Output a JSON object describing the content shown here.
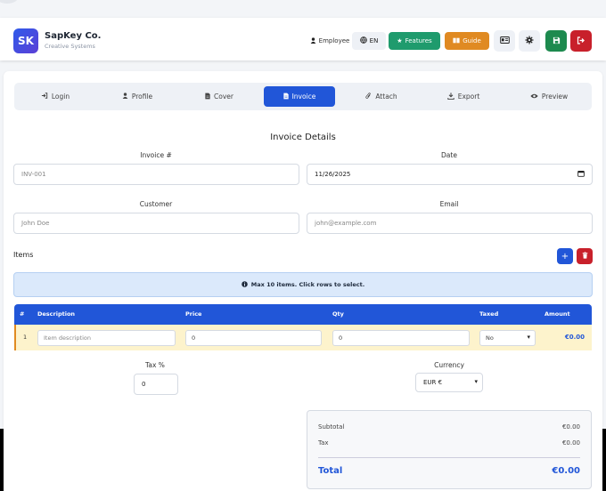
{
  "header": {
    "logo_text": "SK",
    "brand_name": "SapKey Co.",
    "brand_sub": "Creative Systems",
    "role_label": "Employee",
    "lang_label": "EN",
    "features_label": "Features",
    "guide_label": "Guide",
    "colors": {
      "features": "#1f9b6d",
      "guide": "#e08a22",
      "save": "#1d8a4e",
      "logout": "#c8202b"
    }
  },
  "tabs": [
    {
      "label": "Login",
      "icon": "login-icon"
    },
    {
      "label": "Profile",
      "icon": "user-icon"
    },
    {
      "label": "Cover",
      "icon": "document-icon"
    },
    {
      "label": "Invoice",
      "icon": "invoice-icon",
      "active": true
    },
    {
      "label": "Attach",
      "icon": "paperclip-icon"
    },
    {
      "label": "Export",
      "icon": "download-icon"
    },
    {
      "label": "Preview",
      "icon": "eye-icon"
    }
  ],
  "form": {
    "title": "Invoice Details",
    "invoice_label": "Invoice #",
    "invoice_placeholder": "INV-001",
    "date_label": "Date",
    "date_value": "11/26/2025",
    "customer_label": "Customer",
    "customer_placeholder": "John Doe",
    "email_label": "Email",
    "email_placeholder": "john@example.com"
  },
  "items": {
    "label": "Items",
    "info": "Max 10 items. Click rows to select.",
    "headers": {
      "num": "#",
      "description": "Description",
      "price": "Price",
      "qty": "Qty",
      "taxed": "Taxed",
      "amount": "Amount"
    },
    "rows": [
      {
        "num": "1",
        "description_placeholder": "Item description",
        "price": "0",
        "qty": "0",
        "taxed": "No",
        "amount": "€0.00"
      }
    ]
  },
  "tax": {
    "label": "Tax %",
    "value": "0"
  },
  "currency": {
    "label": "Currency",
    "value": "EUR €"
  },
  "summary": {
    "subtotal_label": "Subtotal",
    "subtotal": "€0.00",
    "tax_label": "Tax",
    "tax": "€0.00",
    "total_label": "Total",
    "total": "€0.00"
  }
}
